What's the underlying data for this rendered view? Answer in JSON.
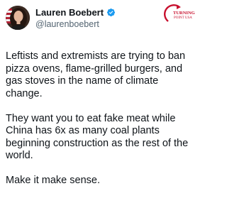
{
  "author": {
    "display_name": "Lauren Boebert",
    "handle": "@laurenboebert",
    "verified_icon": "verified-badge-icon",
    "colors": {
      "verified": "#1d9bf0",
      "handle": "#536471",
      "text": "#0f1419"
    }
  },
  "watermark": {
    "icon": "turning-point-usa-logo",
    "text_line1": "TURNING",
    "text_line2": "POINT USA",
    "color": "#c8102e"
  },
  "post": {
    "paragraphs": [
      "Leftists and extremists are trying to ban pizza ovens, flame-grilled burgers, and gas stoves in the name of climate change.",
      "They want you to eat fake meat while China has 6x as many coal plants beginning construction as the rest of the world.",
      "Make it make sense."
    ]
  }
}
